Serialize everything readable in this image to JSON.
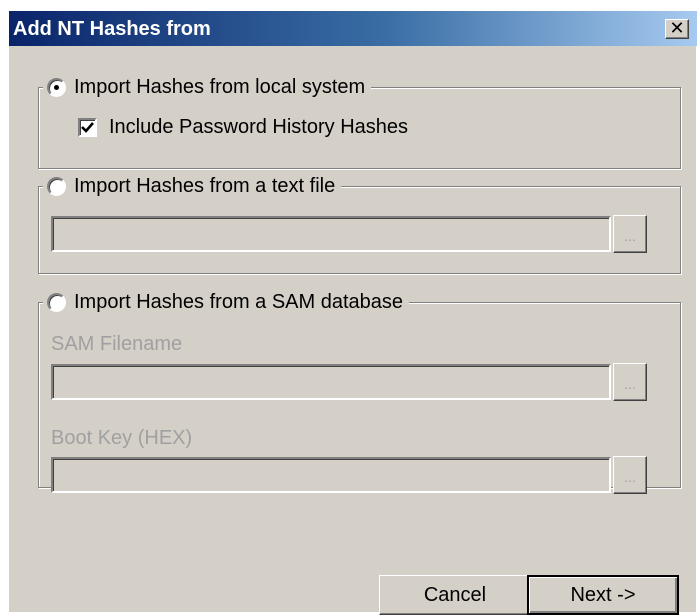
{
  "dialog": {
    "title": "Add NT Hashes from",
    "close_glyph": "✕"
  },
  "local_system": {
    "label": "Import Hashes from local system",
    "selected": true,
    "include_history_label": "Include Password History Hashes",
    "include_history_checked": true
  },
  "text_file": {
    "label": "Import Hashes from a text file",
    "selected": false,
    "path_value": "",
    "browse_label": "..."
  },
  "sam_database": {
    "label": "Import Hashes from a SAM database",
    "selected": false,
    "sam_filename_label": "SAM Filename",
    "sam_filename_value": "",
    "boot_key_label": "Boot Key (HEX)",
    "boot_key_value": "",
    "browse_label": "..."
  },
  "buttons": {
    "cancel": "Cancel",
    "next": "Next ->"
  },
  "icons": {
    "close": "close-icon",
    "check": "checkmark-icon"
  }
}
